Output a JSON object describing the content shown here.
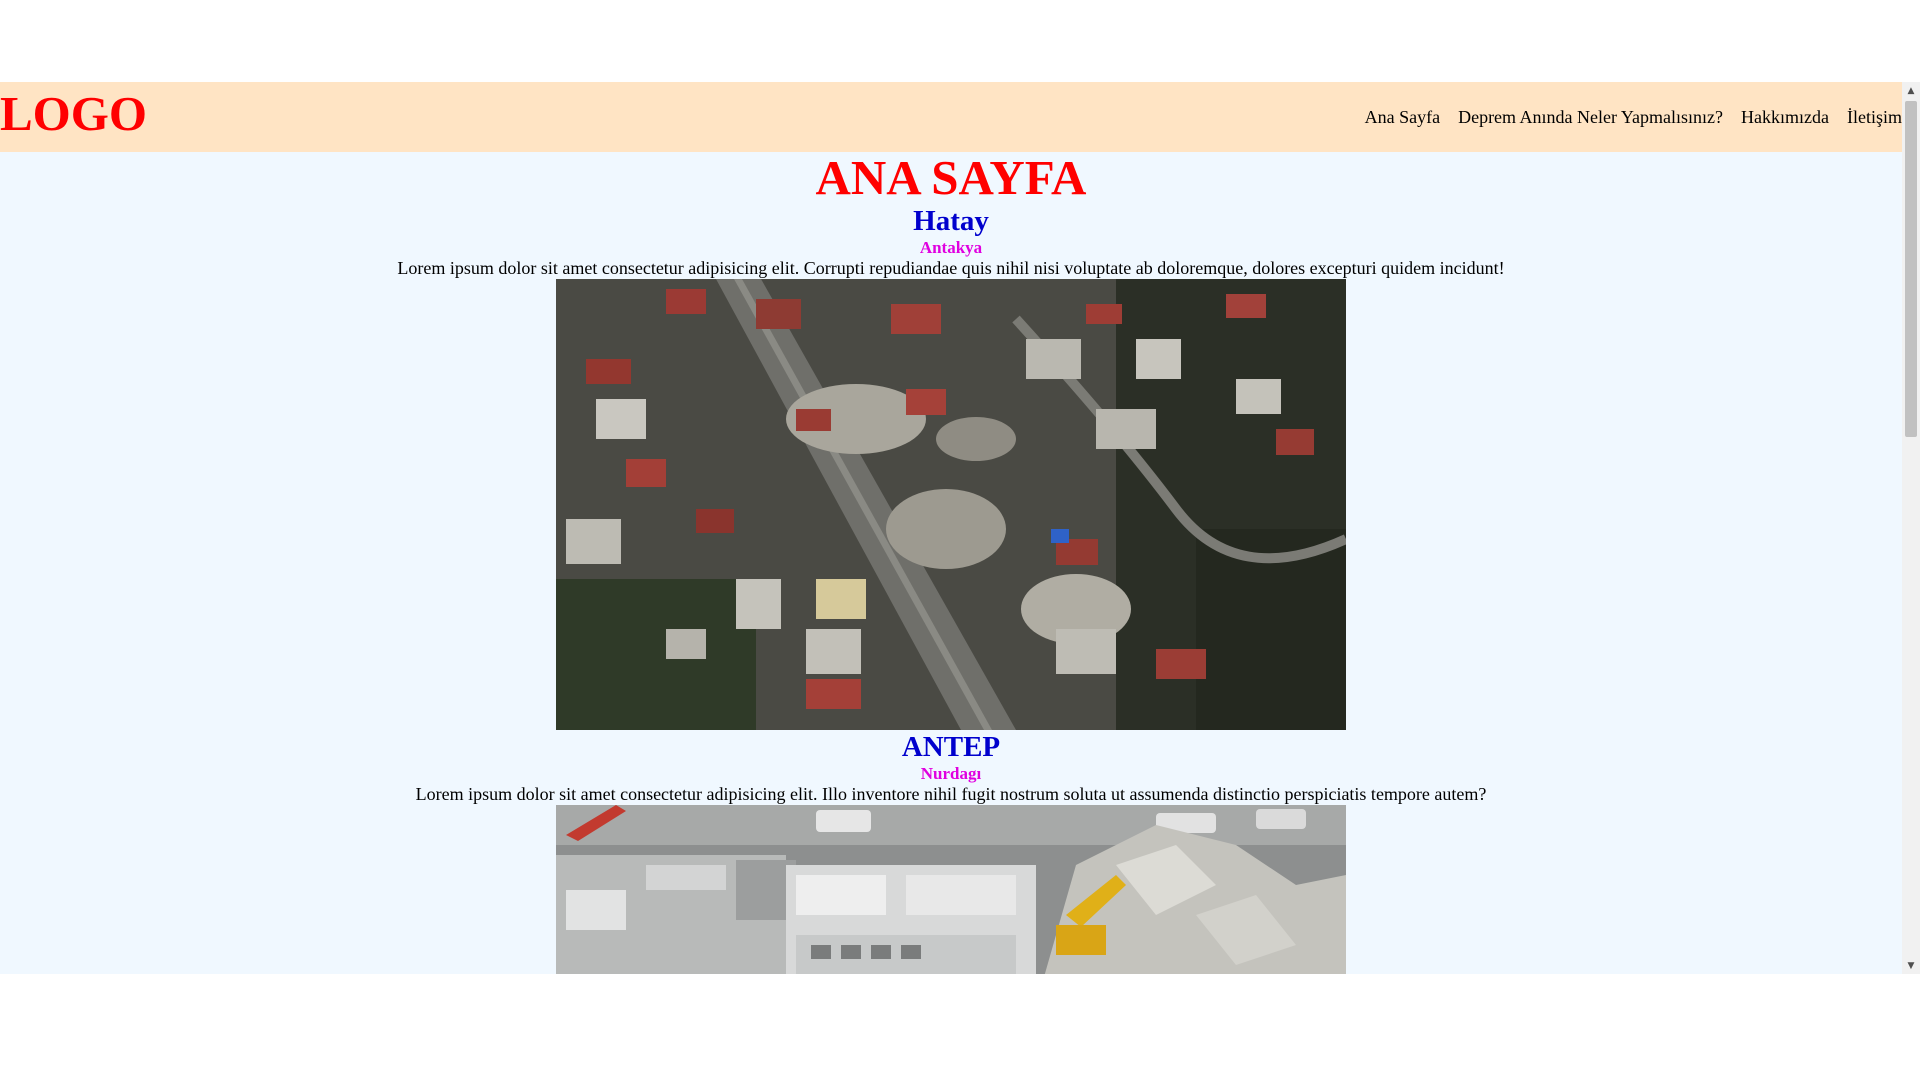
{
  "header": {
    "logo": "LOGO",
    "nav": [
      {
        "label": "Ana Sayfa"
      },
      {
        "label": "Deprem Anında Neler Yapmalısınız?"
      },
      {
        "label": "Hakkımızda"
      },
      {
        "label": "İletişim"
      }
    ]
  },
  "main": {
    "page_title": "ANA SAYFA",
    "sections": [
      {
        "city": "Hatay",
        "district": "Antakya",
        "text": "Lorem ipsum dolor sit amet consectetur adipisicing elit. Corrupti repudiandae quis nihil nisi voluptate ab doloremque, dolores excepturi quidem incidunt!",
        "image": "aerial photo of earthquake-damaged city blocks"
      },
      {
        "city": "ANTEP",
        "district": "Nurdagı",
        "text": "Lorem ipsum dolor sit amet consectetur adipisicing elit. Illo inventore nihil fugit nostrum soluta ut assumenda distinctio perspiciatis tempore autem?",
        "image": "collapsed building with excavator"
      }
    ]
  },
  "colors": {
    "header_bg": "#ffe4c4",
    "page_bg": "#f0f8ff",
    "title_red": "#ff0000",
    "city_blue": "#0000cd",
    "district_magenta": "#e000e0"
  },
  "icons": {
    "scroll_up": "scroll-up-arrow-icon",
    "scroll_down": "scroll-down-arrow-icon"
  }
}
